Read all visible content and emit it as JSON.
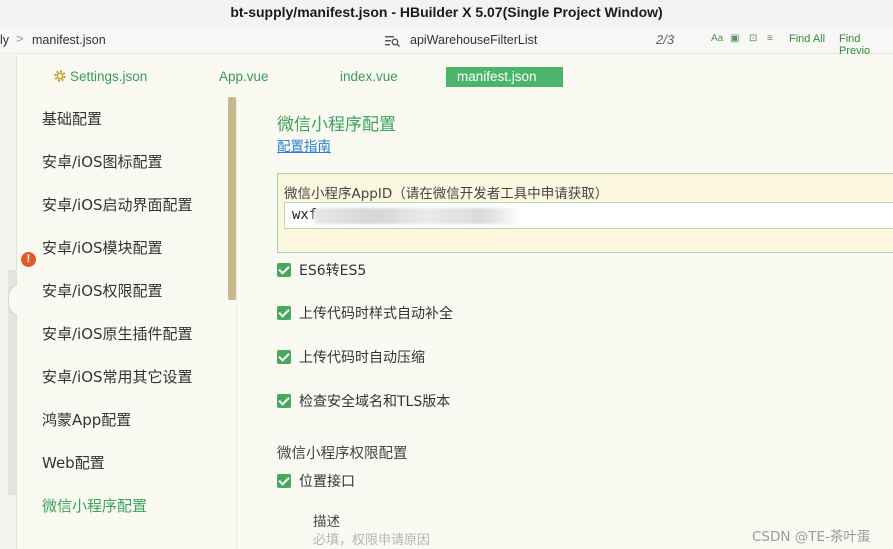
{
  "window": {
    "title": "bt-supply/manifest.json - HBuilder X 5.07(Single Project Window)"
  },
  "breadcrumb": {
    "prev": "ly",
    "separator": ">",
    "file": "manifest.json",
    "symbol": "apiWarehouseFilterList"
  },
  "findbar": {
    "counter": "2/3",
    "find_all": "Find All",
    "find_previous": "Find Previo"
  },
  "tabs": [
    {
      "label": "Settings.json",
      "icon": "gear-icon",
      "active": false
    },
    {
      "label": "App.vue",
      "active": false
    },
    {
      "label": "index.vue",
      "active": false
    },
    {
      "label": "manifest.json",
      "active": true
    }
  ],
  "sidebar": {
    "items": [
      {
        "label": "基础配置"
      },
      {
        "label": "安卓/iOS图标配置",
        "warning": true
      },
      {
        "label": "安卓/iOS启动界面配置"
      },
      {
        "label": "安卓/iOS模块配置"
      },
      {
        "label": "安卓/iOS权限配置"
      },
      {
        "label": "安卓/iOS原生插件配置"
      },
      {
        "label": "安卓/iOS常用其它设置"
      },
      {
        "label": "鸿蒙App配置"
      },
      {
        "label": "Web配置"
      },
      {
        "label": "微信小程序配置",
        "active": true
      }
    ],
    "warning_glyph": "!"
  },
  "main": {
    "title": "微信小程序配置",
    "guide_link": "配置指南",
    "appid": {
      "label": "微信小程序AppID（请在微信开发者工具中申请获取）",
      "value": "wxf"
    },
    "options": [
      {
        "label": "ES6转ES5",
        "checked": true
      },
      {
        "label": "上传代码时样式自动补全",
        "checked": true
      },
      {
        "label": "上传代码时自动压缩",
        "checked": true
      },
      {
        "label": "检查安全域名和TLS版本",
        "checked": true
      }
    ],
    "permissions_title": "微信小程序权限配置",
    "location": {
      "label": "位置接口",
      "checked": true
    },
    "description_label": "描述",
    "description_placeholder": "必填，权限申请原因"
  },
  "watermark": "CSDN @TE-茶叶蛋",
  "colors": {
    "accent_green": "#3aa35c",
    "active_tab_bg": "#4bb56c",
    "link_blue": "#2a7fd4",
    "warning_orange": "#e05a2a"
  }
}
